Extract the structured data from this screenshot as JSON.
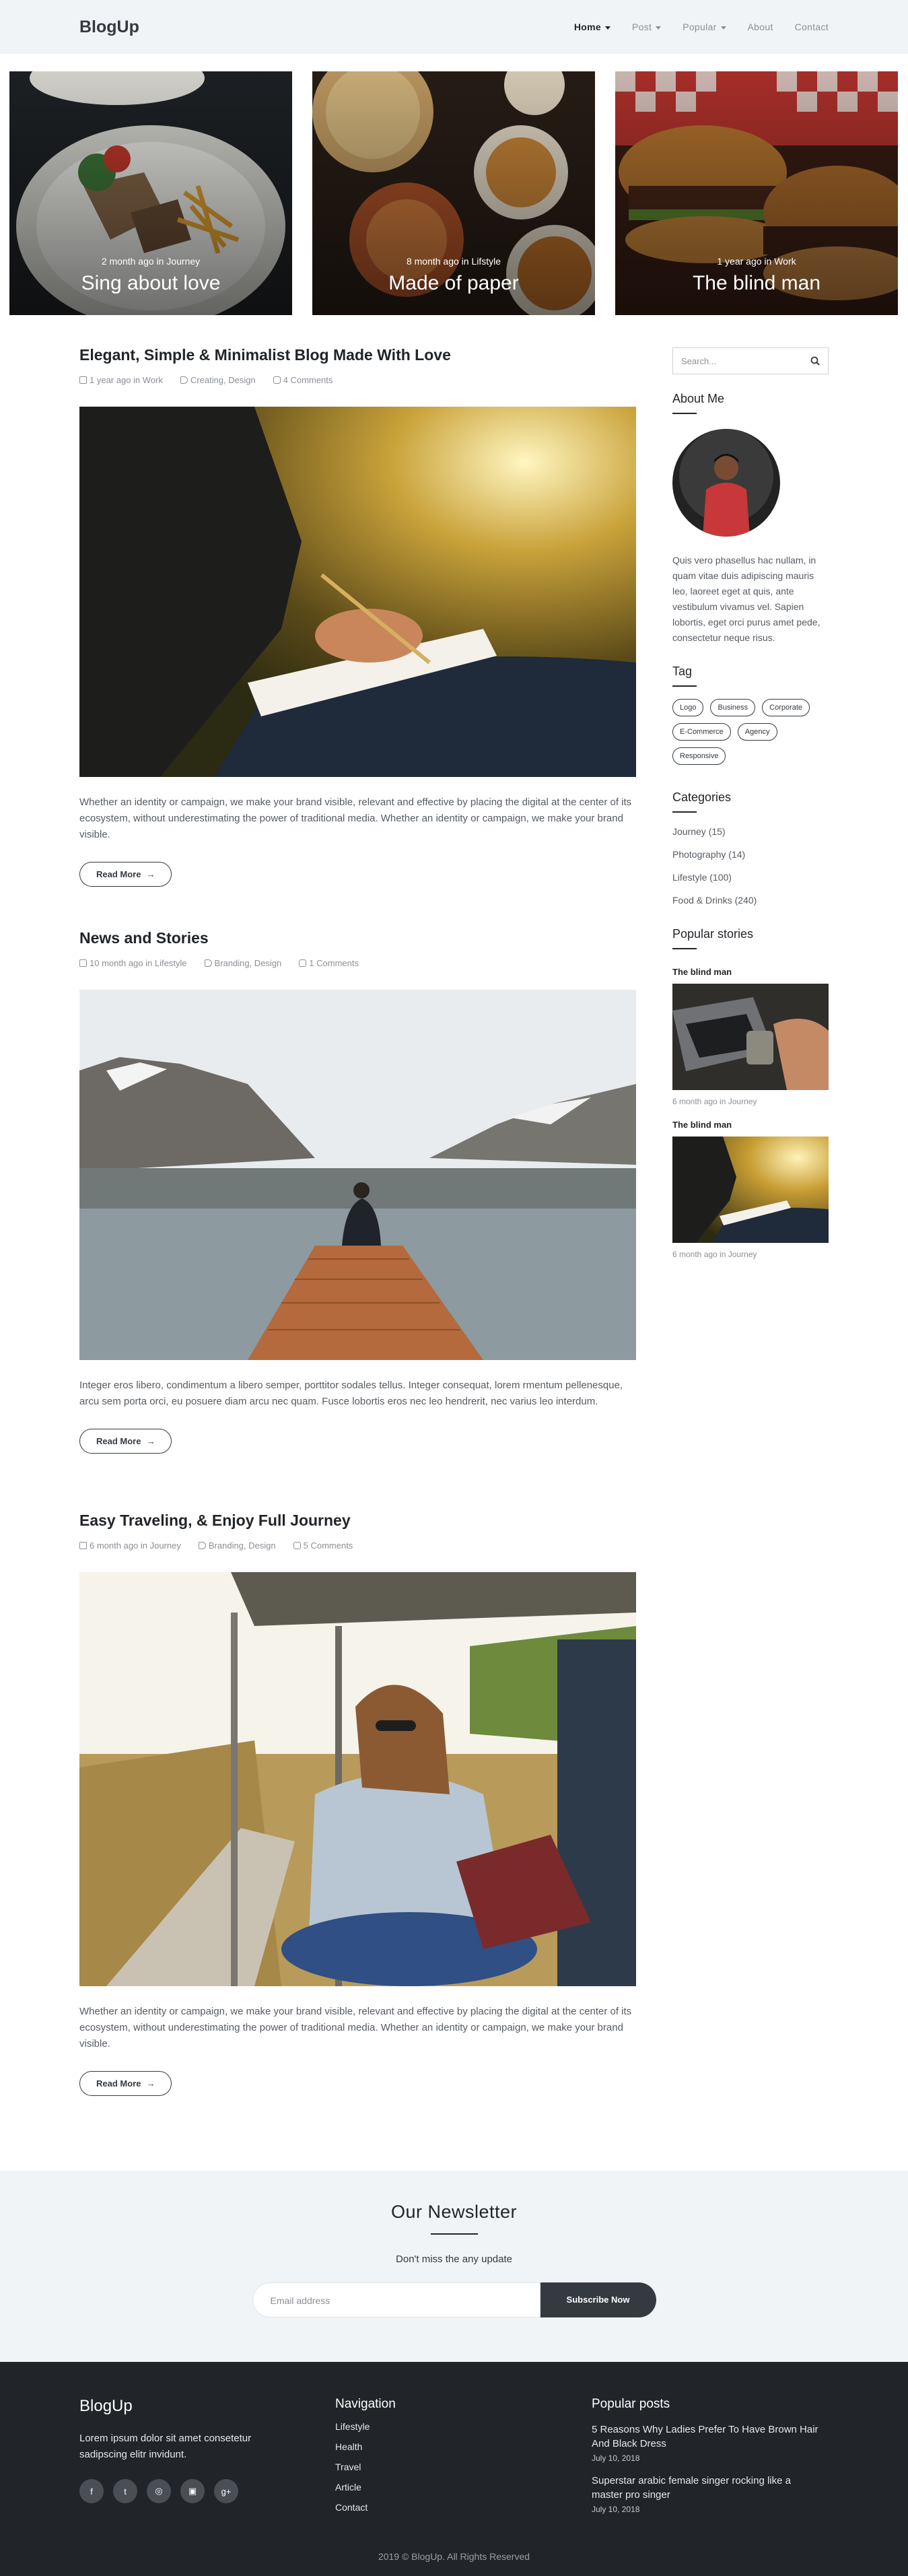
{
  "nav": {
    "brand": "BlogUp",
    "links": [
      {
        "label": "Home",
        "active": true,
        "dropdown": true
      },
      {
        "label": "Post",
        "active": false,
        "dropdown": true
      },
      {
        "label": "Popular",
        "active": false,
        "dropdown": true
      },
      {
        "label": "About",
        "active": false,
        "dropdown": false
      },
      {
        "label": "Contact",
        "active": false,
        "dropdown": false
      }
    ]
  },
  "hero": [
    {
      "meta": "2 month ago in Journey",
      "title": "Sing about love"
    },
    {
      "meta": "8 month ago in Lifstyle",
      "title": "Made of paper"
    },
    {
      "meta": "1 year ago in Work",
      "title": "The blind man"
    }
  ],
  "posts": [
    {
      "title": "Elegant, Simple & Minimalist Blog Made With Love",
      "date": "1 year ago in Work",
      "tags": "Creating, Design",
      "comments": "4 Comments",
      "text": "Whether an identity or campaign, we make your brand visible, relevant and effective by placing the digital at the center of its ecosystem, without underestimating the power of traditional media. Whether an identity or campaign, we make your brand visible.",
      "button": "Read More"
    },
    {
      "title": "News and Stories",
      "date": "10 month ago in Lifestyle",
      "tags": "Branding, Design",
      "comments": "1 Comments",
      "text": "Integer eros libero, condimentum a libero semper, porttitor sodales tellus. Integer consequat, lorem rmentum pellenesque, arcu sem porta orci, eu posuere diam arcu nec quam. Fusce lobortis eros nec leo hendrerit, nec varius leo interdum.",
      "button": "Read More"
    },
    {
      "title": "Easy Traveling, & Enjoy Full Journey",
      "date": "6 month ago in Journey",
      "tags": "Branding, Design",
      "comments": "5 Comments",
      "text": "Whether an identity or campaign, we make your brand visible, relevant and effective by placing the digital at the center of its ecosystem, without underestimating the power of traditional media. Whether an identity or campaign, we make your brand visible.",
      "button": "Read More"
    }
  ],
  "sidebar": {
    "search_placeholder": "Search...",
    "about_heading": "About Me",
    "about_text": "Quis vero phasellus hac nullam, in quam vitae duis adipiscing mauris leo, laoreet eget at quis, ante vestibulum vivamus vel. Sapien lobortis, eget orci purus amet pede, consectetur neque risus.",
    "tag_heading": "Tag",
    "tags": [
      "Logo",
      "Business",
      "Corporate",
      "E-Commerce",
      "Agency",
      "Responsive"
    ],
    "categories_heading": "Categories",
    "categories": [
      "Journey (15)",
      "Photography (14)",
      "Lifestyle (100)",
      "Food & Drinks (240)"
    ],
    "popular_heading": "Popular stories",
    "popular": [
      {
        "title": "The blind man",
        "meta": "6 month ago in Journey"
      },
      {
        "title": "The blind man",
        "meta": "6 month ago in Journey"
      }
    ]
  },
  "newsletter": {
    "title": "Our Newsletter",
    "subtitle": "Don't miss the any update",
    "placeholder": "Email address",
    "button": "Subscribe Now"
  },
  "footer": {
    "brand": "BlogUp",
    "description": "Lorem ipsum dolor sit amet consetetur sadipscing elitr invidunt.",
    "socials": [
      "facebook-icon",
      "twitter-icon",
      "dribbble-icon",
      "instagram-icon",
      "google-plus-icon"
    ],
    "nav_heading": "Navigation",
    "nav_links": [
      "Lifestyle",
      "Health",
      "Travel",
      "Article",
      "Contact"
    ],
    "posts_heading": "Popular posts",
    "posts": [
      {
        "title": "5 Reasons Why Ladies Prefer To Have Brown Hair And Black Dress",
        "date": "July 10, 2018"
      },
      {
        "title": "Superstar arabic female singer rocking like a master pro singer",
        "date": "July 10, 2018"
      }
    ],
    "copyright": "2019 © BlogUp. All Rights Reserved"
  }
}
